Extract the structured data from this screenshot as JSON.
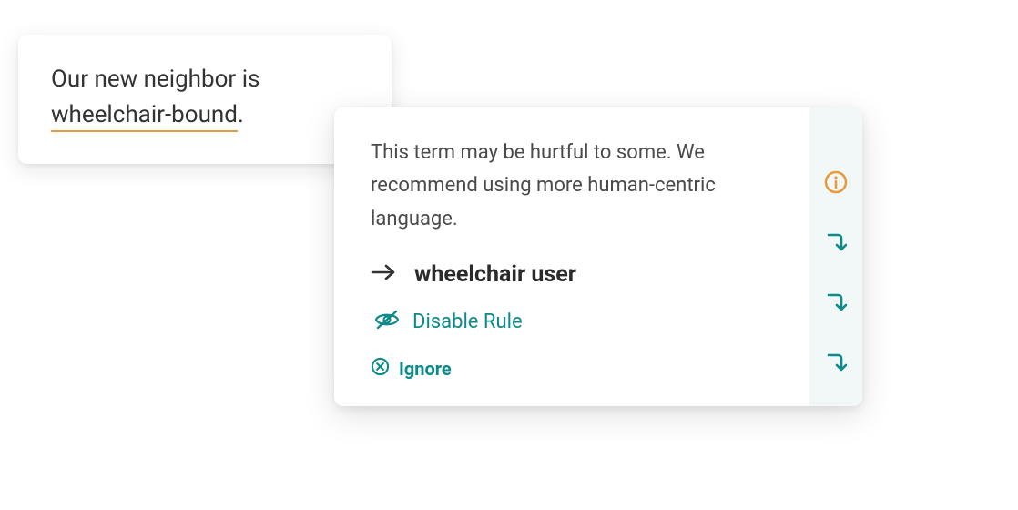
{
  "text_card": {
    "line1": "Our new neighbor is",
    "flagged_term": "wheelchair-bound",
    "period": "."
  },
  "suggestion": {
    "explanation": "This term may be hurtful to some. We recommend using more human-centric language.",
    "replacement": "wheelchair user",
    "disable_label": "Disable Rule",
    "ignore_label": "Ignore"
  },
  "colors": {
    "accent_orange": "#e89a3c",
    "accent_teal": "#0d8a8a"
  }
}
